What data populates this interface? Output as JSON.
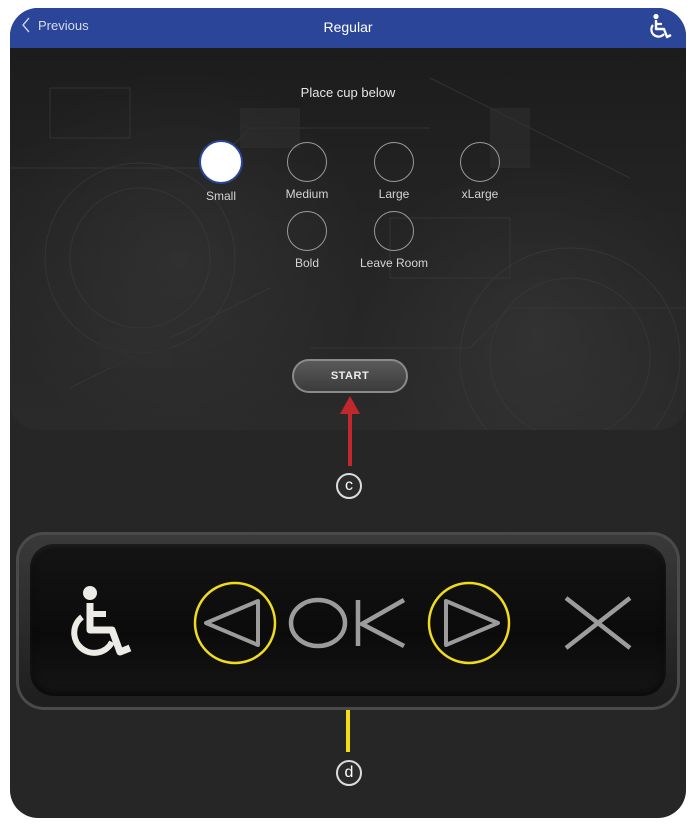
{
  "header": {
    "back_label": "Previous",
    "title": "Regular",
    "accessibility_icon": "wheelchair-icon"
  },
  "screen": {
    "instruction": "Place cup below",
    "options": [
      {
        "label": "Small",
        "selected": true
      },
      {
        "label": "Medium",
        "selected": false
      },
      {
        "label": "Large",
        "selected": false
      },
      {
        "label": "xLarge",
        "selected": false
      },
      {
        "label": "Bold",
        "selected": false
      },
      {
        "label": "Leave Room",
        "selected": false
      }
    ],
    "start_label": "START"
  },
  "callouts": {
    "c": "c",
    "d": "d"
  },
  "panel": {
    "buttons": [
      "wheelchair-icon",
      "left-triangle-icon",
      "ok-text-icon",
      "right-triangle-icon",
      "x-icon"
    ],
    "ok_text": "OK"
  },
  "colors": {
    "header_bg": "#2b4699",
    "red_arrow": "#c0282e",
    "yellow_arrow": "#f4dd14",
    "highlight_ring": "#f0dc1c"
  }
}
